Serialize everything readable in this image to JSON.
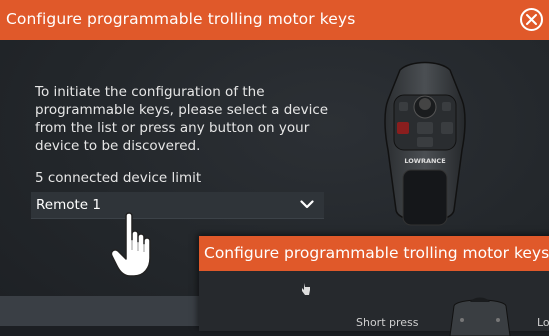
{
  "dialog": {
    "title": "Configure programmable trolling motor keys",
    "instructions": "To initiate the configuration of the programmable keys, please select a device from the list or press any button on your device to be discovered.",
    "device_limit_label": "5 connected device limit",
    "device_select": {
      "selected": "Remote 1"
    },
    "remote_brand": "LOWRANCE"
  },
  "overlay_dialog": {
    "title": "Configure programmable trolling motor keys",
    "short_press_label": "Short press",
    "cut_label": "Lo"
  },
  "colors": {
    "accent": "#e0592a",
    "background": "#23272b",
    "dropdown": "#2f3439",
    "text": "#e6e6e6"
  },
  "icons": {
    "close": "close-circle-icon",
    "dropdown": "chevron-down-icon",
    "pointer": "hand-pointer-icon"
  }
}
